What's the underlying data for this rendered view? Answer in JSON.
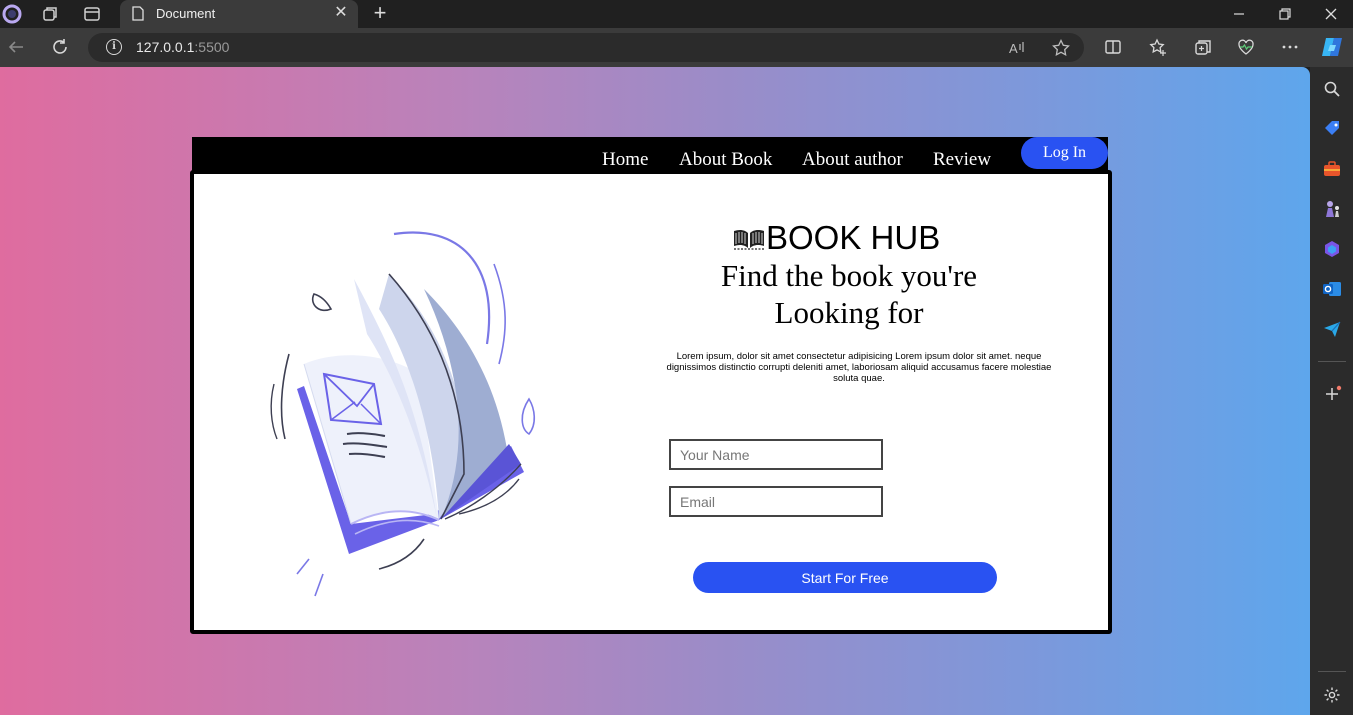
{
  "browser": {
    "tab_title": "Document",
    "url_host": "127.0.0.1",
    "url_port": ":5500"
  },
  "site": {
    "nav": [
      "Home",
      "About Book",
      "About author",
      "Review"
    ],
    "login_label": "Log In",
    "brand_name": "BOOK HUB",
    "headline_line1": "Find the book you're",
    "headline_line2": "Looking for",
    "description": "Lorem ipsum, dolor sit amet consectetur adipisicing Lorem ipsum dolor sit amet. neque dignissimos distinctio corrupti deleniti amet, laboriosam aliquid accusamus facere molestiae soluta quae.",
    "name_placeholder": "Your Name",
    "email_placeholder": "Email",
    "cta_label": "Start For Free"
  },
  "colors": {
    "accent": "#2952f2",
    "gradient_left": "#df6c9f",
    "gradient_right": "#5ea6ec"
  }
}
